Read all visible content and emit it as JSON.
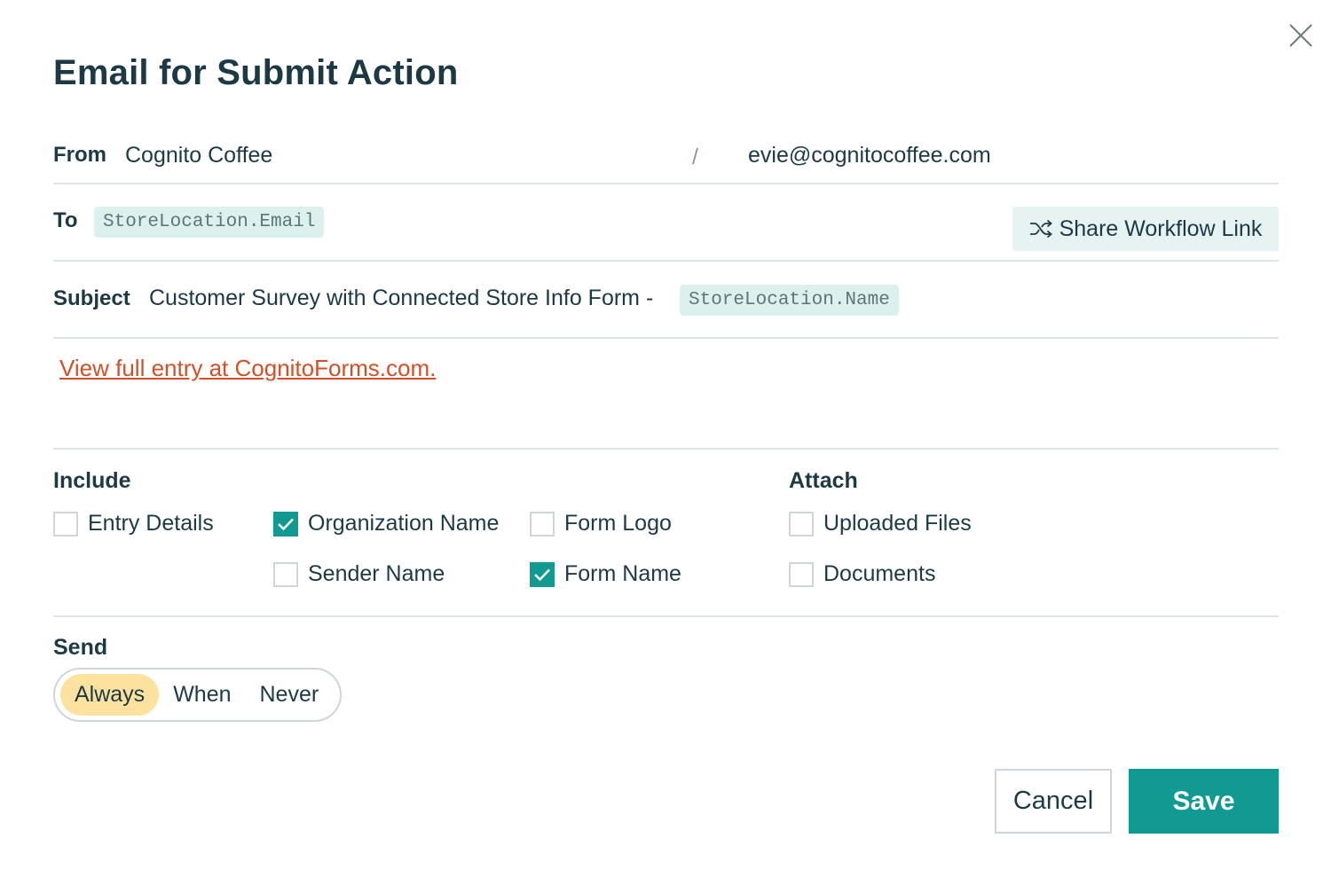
{
  "dialog": {
    "title": "Email for Submit Action",
    "close_icon": "close-icon"
  },
  "from": {
    "label": "From",
    "name": "Cognito Coffee",
    "separator": "/",
    "email": "evie@cognitocoffee.com"
  },
  "to": {
    "label": "To",
    "token": "StoreLocation.Email",
    "share_button": "Share Workflow Link",
    "share_icon": "shuffle-icon"
  },
  "subject": {
    "label": "Subject",
    "text": "Customer Survey with Connected Store Info Form -",
    "token": "StoreLocation.Name"
  },
  "body": {
    "link_text": "View full entry at CognitoForms.com."
  },
  "include": {
    "label": "Include",
    "options": [
      {
        "label": "Entry Details",
        "checked": false
      },
      {
        "label": "Organization Name",
        "checked": true
      },
      {
        "label": "Form Logo",
        "checked": false
      },
      {
        "label": "Sender Name",
        "checked": false
      },
      {
        "label": "Form Name",
        "checked": true
      }
    ]
  },
  "attach": {
    "label": "Attach",
    "options": [
      {
        "label": "Uploaded Files",
        "checked": false
      },
      {
        "label": "Documents",
        "checked": false
      }
    ]
  },
  "send": {
    "label": "Send",
    "options": [
      "Always",
      "When",
      "Never"
    ],
    "selected": "Always"
  },
  "actions": {
    "cancel": "Cancel",
    "save": "Save"
  },
  "colors": {
    "accent": "#109a91",
    "link": "#d0502a",
    "token_bg": "#dcf1ee",
    "toggle_active": "#fde29f",
    "text": "#1d3a44"
  }
}
